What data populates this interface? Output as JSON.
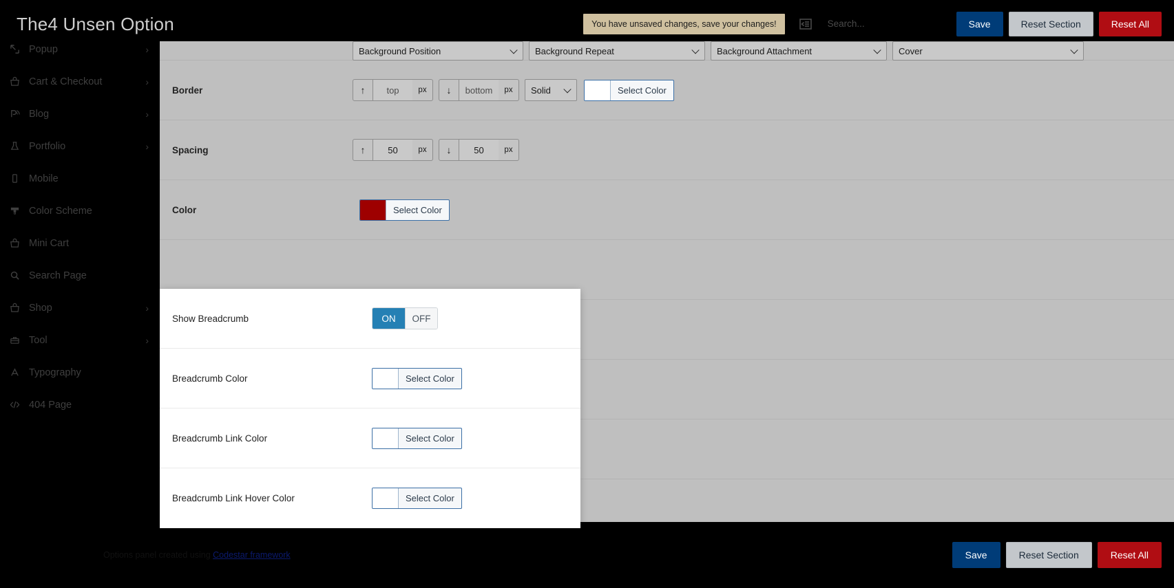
{
  "header": {
    "title": "The4 Unsen Option",
    "unsaved_notice": "You have unsaved changes, save your changes!",
    "collapse_icon": "collapse-panel-icon",
    "search_placeholder": "Search...",
    "search_value": "",
    "save_label": "Save",
    "reset_section_label": "Reset Section",
    "reset_all_label": "Reset All"
  },
  "colors": {
    "accent_blue": "#2580b4",
    "save_navy": "#003c78",
    "reset_all_red": "#b00d13",
    "notice_tan": "#cfc09f",
    "color_row_swatch": "#9e0000",
    "panel_white": "#ffffff",
    "content_gray": "#bfbfbf",
    "link_blue": "#0b1a6e"
  },
  "sidebar": {
    "items": [
      {
        "label": "Popup",
        "icon": "popup-icon",
        "chevron": "›",
        "has_chevron": true
      },
      {
        "label": "Cart & Checkout",
        "icon": "cart-icon",
        "chevron": "›",
        "has_chevron": true
      },
      {
        "label": "Blog",
        "icon": "blog-rss-icon",
        "chevron": "›",
        "has_chevron": true
      },
      {
        "label": "Portfolio",
        "icon": "flask-icon",
        "chevron": "›",
        "has_chevron": true
      },
      {
        "label": "Mobile",
        "icon": "mobile-icon",
        "chevron": "",
        "has_chevron": false
      },
      {
        "label": "Color Scheme",
        "icon": "paint-brush-icon",
        "chevron": "",
        "has_chevron": false
      },
      {
        "label": "Mini Cart",
        "icon": "cart-icon",
        "chevron": "",
        "has_chevron": false
      },
      {
        "label": "Search Page",
        "icon": "search-icon",
        "chevron": "",
        "has_chevron": false
      },
      {
        "label": "Shop",
        "icon": "cart-icon",
        "chevron": "›",
        "has_chevron": true
      },
      {
        "label": "Tool",
        "icon": "toolbox-icon",
        "chevron": "›",
        "has_chevron": true
      },
      {
        "label": "Typography",
        "icon": "typography-a-icon",
        "chevron": "",
        "has_chevron": false
      },
      {
        "label": "404 Page",
        "icon": "code-icon",
        "chevron": "",
        "has_chevron": false
      }
    ]
  },
  "main": {
    "background_selects": [
      {
        "name": "background-position",
        "value": "Background Position"
      },
      {
        "name": "background-repeat",
        "value": "Background Repeat"
      },
      {
        "name": "background-attachment",
        "value": "Background Attachment"
      },
      {
        "name": "background-size",
        "value": "Cover"
      }
    ],
    "border_row": {
      "label": "Border",
      "top_arrow": "↑",
      "top_placeholder": "top",
      "top_value": "",
      "top_unit": "px",
      "bottom_arrow": "↓",
      "bottom_placeholder": "bottom",
      "bottom_value": "",
      "bottom_unit": "px",
      "style_value": "Solid",
      "color_label": "Select Color",
      "color_swatch": "#ffffff"
    },
    "spacing_row": {
      "label": "Spacing",
      "top_arrow": "↑",
      "top_value": "50",
      "top_unit": "px",
      "bottom_arrow": "↓",
      "bottom_value": "50",
      "bottom_unit": "px"
    },
    "color_row": {
      "label": "Color",
      "color_label": "Select Color",
      "color_swatch": "#9e0000"
    }
  },
  "panel": {
    "show_breadcrumb": {
      "label": "Show Breadcrumb",
      "on_label": "ON",
      "off_label": "OFF",
      "state": "ON"
    },
    "breadcrumb_color": {
      "label": "Breadcrumb Color",
      "color_label": "Select Color",
      "color_swatch": "#ffffff"
    },
    "breadcrumb_link_color": {
      "label": "Breadcrumb Link Color",
      "color_label": "Select Color",
      "color_swatch": "#ffffff"
    },
    "breadcrumb_link_hover_color": {
      "label": "Breadcrumb Link Hover Color",
      "color_label": "Select Color",
      "color_swatch": "#ffffff"
    }
  },
  "footer": {
    "note_prefix": "Options panel created using ",
    "note_link": "Codestar framework",
    "save_label": "Save",
    "reset_section_label": "Reset Section",
    "reset_all_label": "Reset All"
  }
}
